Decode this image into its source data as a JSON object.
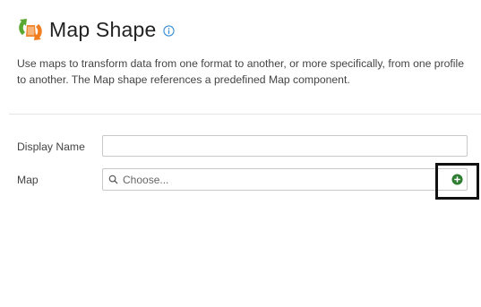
{
  "header": {
    "title": "Map Shape",
    "shape_icon": "map-shape-icon",
    "info_icon": "info-icon"
  },
  "description": "Use maps to transform data from one format to another, or more specifically, from one profile to another. The Map shape references a predefined Map component.",
  "form": {
    "display_name": {
      "label": "Display Name",
      "value": ""
    },
    "map": {
      "label": "Map",
      "placeholder": "Choose...",
      "search_icon": "search-icon",
      "add_icon": "add-circle-icon"
    }
  },
  "colors": {
    "add_button": "#2e7d32",
    "icon_orange": "#f07d1e",
    "icon_green": "#5aa832",
    "info_blue": "#3a8fd6",
    "highlight": "#111111"
  }
}
